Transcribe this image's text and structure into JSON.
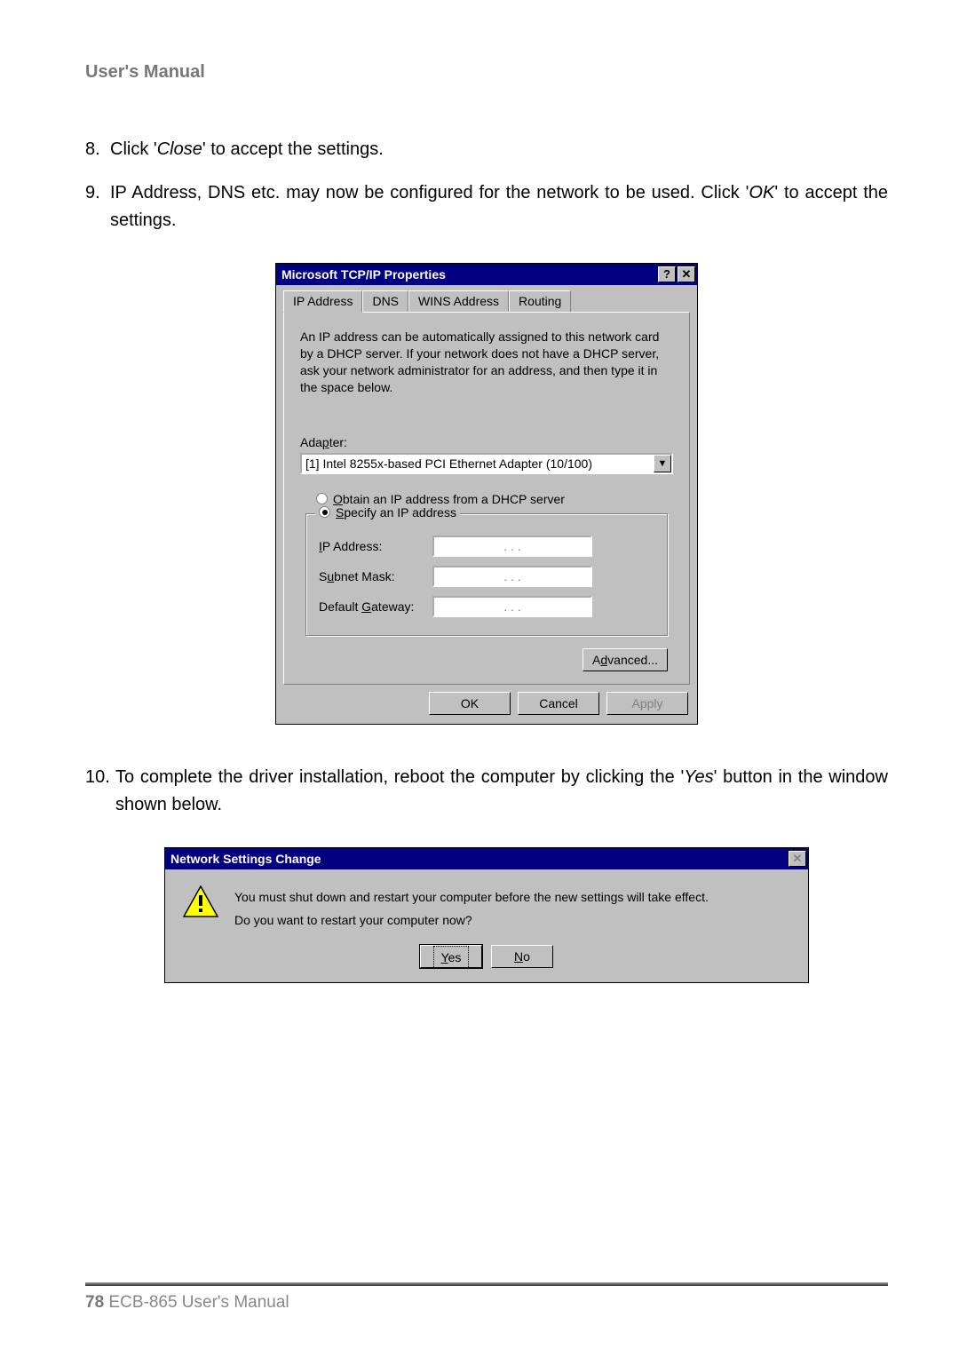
{
  "header": {
    "title": "User's Manual"
  },
  "steps": {
    "s8": {
      "num": "8.",
      "pre": "Click '",
      "em": "Close",
      "post": "' to accept the settings."
    },
    "s9": {
      "num": "9.",
      "pre": "IP Address, DNS etc. may now be configured for the network to be used. Click '",
      "em": "OK",
      "post": "' to accept the settings."
    },
    "s10": {
      "num": "10.",
      "pre": "To complete the driver installation, reboot the computer by clicking the '",
      "em": "Yes",
      "post": "' button in the window shown below."
    }
  },
  "tcpip": {
    "title": "Microsoft TCP/IP Properties",
    "help_glyph": "?",
    "close_glyph": "✕",
    "tabs": {
      "ip": "IP Address",
      "dns": "DNS",
      "wins": "WINS Address",
      "routing": "Routing"
    },
    "desc": "An IP address can be automatically assigned to this network card by a DHCP server.  If your network does not have a DHCP server, ask your network administrator for an address, and then type it in the space below.",
    "adapter_label_pre": "Ada",
    "adapter_label_accel": "p",
    "adapter_label_post": "ter:",
    "adapter_value": "[1] Intel 8255x-based PCI Ethernet Adapter (10/100)",
    "combo_glyph": "▼",
    "radio1_accel": "O",
    "radio1_rest": "btain an IP address from a DHCP server",
    "radio2_accel": "S",
    "radio2_rest": "pecify an IP address",
    "fld_ip_accel": "I",
    "fld_ip_rest": "P Address:",
    "fld_sn_pre": "S",
    "fld_sn_accel": "u",
    "fld_sn_rest": "bnet Mask:",
    "fld_gw_pre": "Default ",
    "fld_gw_accel": "G",
    "fld_gw_rest": "ateway:",
    "ip_dots": ".       .       .",
    "advanced_pre": "A",
    "advanced_accel": "d",
    "advanced_rest": "vanced...",
    "ok": "OK",
    "cancel": "Cancel",
    "apply": "Apply"
  },
  "netchg": {
    "title": "Network Settings Change",
    "close_glyph": "✕",
    "line1": "You must shut down and restart your computer before the new settings will take effect.",
    "line2": "Do you want to restart your computer now?",
    "yes_accel": "Y",
    "yes_rest": "es",
    "no_accel": "N",
    "no_rest": "o"
  },
  "footer": {
    "page_num": "78",
    "rest": " ECB-865 User's Manual"
  }
}
